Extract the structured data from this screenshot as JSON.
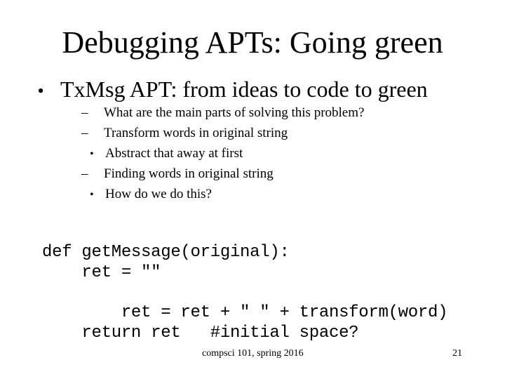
{
  "slide": {
    "title": "Debugging APTs: Going green",
    "bullet": "TxMsg APT: from ideas to code to green",
    "bullet_marker": "•",
    "dash_marker": "–",
    "subbullets": [
      {
        "level": 1,
        "text": "What are the main parts of solving this problem?"
      },
      {
        "level": 1,
        "text": "Transform words in original string"
      },
      {
        "level": 2,
        "text": "Abstract that away at first"
      },
      {
        "level": 1,
        "text": "Finding words in original string"
      },
      {
        "level": 2,
        "text": "How do we do this?"
      }
    ],
    "code": [
      "def getMessage(original):",
      "    ret = \"\"",
      "        ret = ret + \" \" + transform(word)",
      "    return ret   #initial space?"
    ],
    "footer": "compsci 101, spring 2016",
    "page_number": "21"
  }
}
